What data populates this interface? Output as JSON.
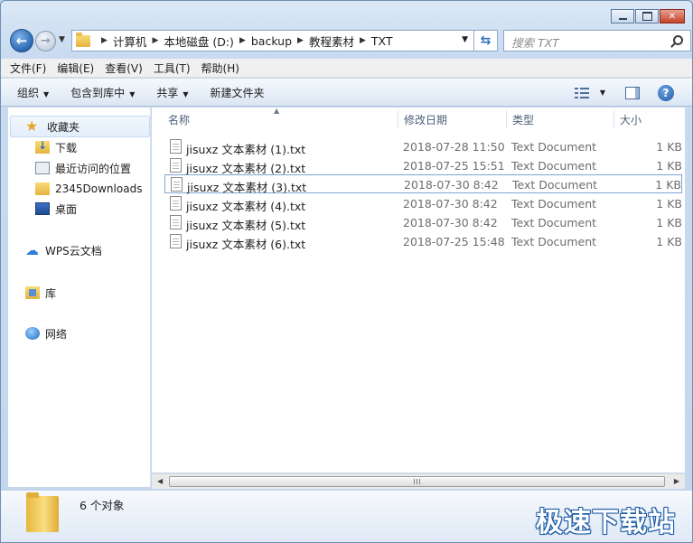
{
  "window": {
    "caption_close": "✕"
  },
  "address": {
    "breadcrumbs": [
      "计算机",
      "本地磁盘 (D:)",
      "backup",
      "教程素材",
      "TXT"
    ],
    "search_placeholder": "搜索 TXT"
  },
  "menu": [
    "文件(F)",
    "编辑(E)",
    "查看(V)",
    "工具(T)",
    "帮助(H)"
  ],
  "toolbar": {
    "organize": "组织",
    "include_in_library": "包含到库中",
    "share": "共享",
    "new_folder": "新建文件夹",
    "help": "?"
  },
  "nav": {
    "favorites": "收藏夹",
    "downloads": "下载",
    "recent": "最近访问的位置",
    "downloads2345": "2345Downloads",
    "desktop": "桌面",
    "wps_cloud": "WPS云文档",
    "libraries": "库",
    "network": "网络"
  },
  "columns": {
    "name": "名称",
    "date": "修改日期",
    "type": "类型",
    "size": "大小"
  },
  "files": [
    {
      "name": "jisuxz 文本素材 (1).txt",
      "date": "2018-07-28 11:50",
      "type": "Text Document",
      "size": "1 KB"
    },
    {
      "name": "jisuxz 文本素材 (2).txt",
      "date": "2018-07-25 15:51",
      "type": "Text Document",
      "size": "1 KB"
    },
    {
      "name": "jisuxz 文本素材 (3).txt",
      "date": "2018-07-30 8:42",
      "type": "Text Document",
      "size": "1 KB"
    },
    {
      "name": "jisuxz 文本素材 (4).txt",
      "date": "2018-07-30 8:42",
      "type": "Text Document",
      "size": "1 KB"
    },
    {
      "name": "jisuxz 文本素材 (5).txt",
      "date": "2018-07-30 8:42",
      "type": "Text Document",
      "size": "1 KB"
    },
    {
      "name": "jisuxz 文本素材 (6).txt",
      "date": "2018-07-25 15:48",
      "type": "Text Document",
      "size": "1 KB"
    }
  ],
  "status": {
    "object_count": "6 个对象"
  },
  "watermark": "极速下载站"
}
